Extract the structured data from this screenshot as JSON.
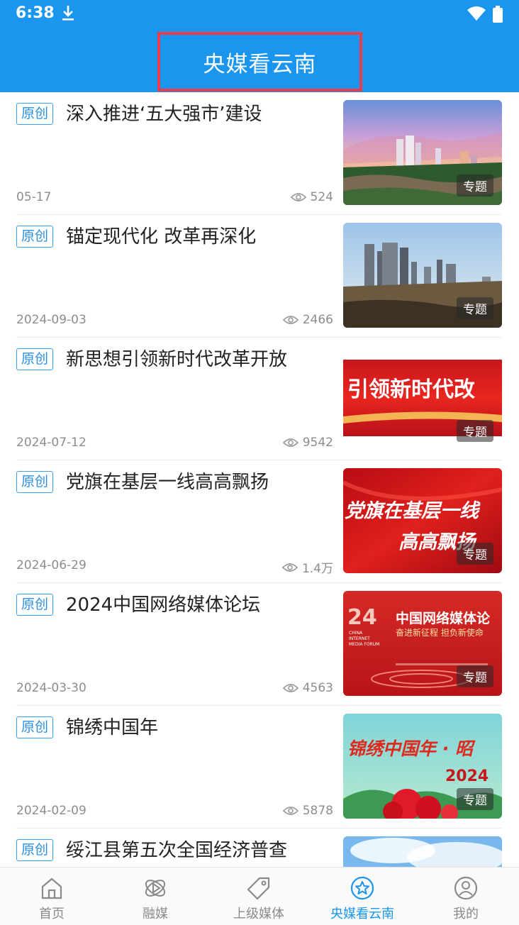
{
  "status_bar": {
    "time": "6:38"
  },
  "header": {
    "title": "央媒看云南"
  },
  "colors": {
    "primary": "#1a96ef",
    "highlight_border": "#ee3d4a",
    "badge": "#2a8fe2"
  },
  "articles": [
    {
      "badge": "原创",
      "title": "深入推进‘五大强市’建设",
      "date": "05-17",
      "views": "524",
      "tag": "专题"
    },
    {
      "badge": "原创",
      "title": "锚定现代化 改革再深化",
      "date": "2024-09-03",
      "views": "2466",
      "tag": "专题"
    },
    {
      "badge": "原创",
      "title": "新思想引领新时代改革开放",
      "date": "2024-07-12",
      "views": "9542",
      "tag": "专题",
      "image_text": "引领新时代改"
    },
    {
      "badge": "原创",
      "title": "党旗在基层一线高高飘扬",
      "date": "2024-06-29",
      "views": "1.4万",
      "tag": "专题",
      "image_text_1": "党旗在基层一线",
      "image_text_2": "高高飘扬"
    },
    {
      "badge": "原创",
      "title": "2024中国网络媒体论坛",
      "date": "2024-03-30",
      "views": "4563",
      "tag": "专题",
      "image_text_1": "24",
      "image_text_2": "中国网络媒体论",
      "image_text_3": "奋进新征程 担负新使命",
      "image_text_4": "CHINA INTERNET MEDIA FORUM"
    },
    {
      "badge": "原创",
      "title": "锦绣中国年",
      "date": "2024-02-09",
      "views": "5878",
      "tag": "专题",
      "image_text_1": "锦绣中国年 · 昭",
      "image_text_2": "2024"
    },
    {
      "badge": "原创",
      "title": "绥江县第五次全国经济普查"
    }
  ],
  "bottom_nav": [
    {
      "label": "首页",
      "icon": "home-icon",
      "active": false
    },
    {
      "label": "融媒",
      "icon": "media-play-icon",
      "active": false
    },
    {
      "label": "上级媒体",
      "icon": "tag-icon",
      "active": false
    },
    {
      "label": "央媒看云南",
      "icon": "star-icon",
      "active": true
    },
    {
      "label": "我的",
      "icon": "user-icon",
      "active": false
    }
  ]
}
